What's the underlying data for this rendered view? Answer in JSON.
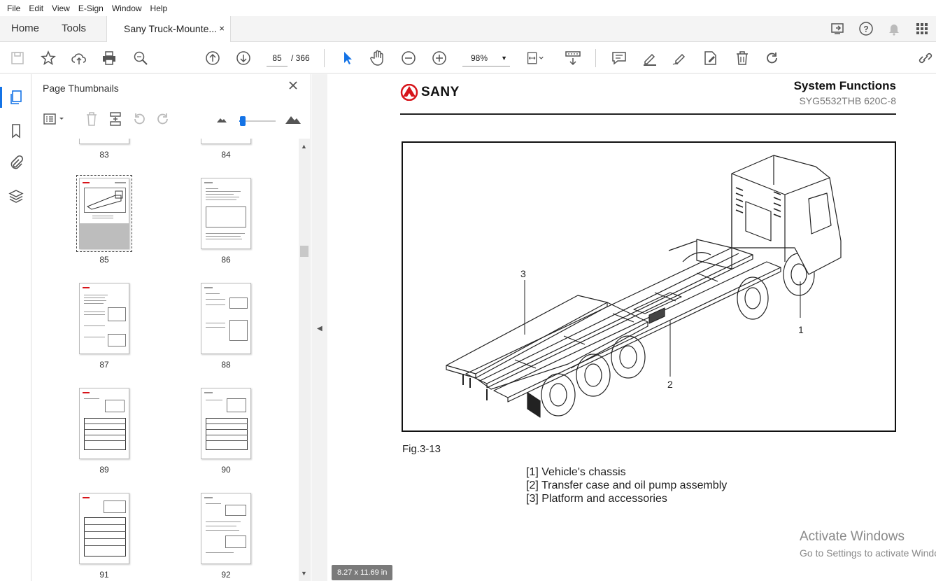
{
  "menu": [
    "File",
    "Edit",
    "View",
    "E-Sign",
    "Window",
    "Help"
  ],
  "tabs": {
    "home": "Home",
    "tools": "Tools",
    "document": "Sany Truck-Mounte...",
    "close": "×"
  },
  "toolbar": {
    "page_current": "85",
    "page_total": "/  366",
    "zoom": "98%"
  },
  "panel": {
    "title": "Page Thumbnails"
  },
  "thumbnails": [
    {
      "label": "83"
    },
    {
      "label": "84"
    },
    {
      "label": "85"
    },
    {
      "label": "86"
    },
    {
      "label": "87"
    },
    {
      "label": "88"
    },
    {
      "label": "89"
    },
    {
      "label": "90"
    },
    {
      "label": "91"
    },
    {
      "label": "92"
    }
  ],
  "document": {
    "brand": "SANY",
    "title": "System Functions",
    "model": "SYG5532THB 620C-8",
    "callouts": [
      "3",
      "1",
      "2"
    ],
    "caption": "Fig.3-13",
    "legend": [
      "[1] Vehicle's chassis",
      "[2] Transfer case and oil pump assembly",
      "[3] Platform and accessories"
    ],
    "page_size": "8.27 x 11.69 in"
  },
  "watermark": {
    "line1": "Activate Windows",
    "line2": "Go to Settings to activate Windows."
  },
  "colors": {
    "accent": "#1473e6",
    "brand_red": "#d7141a"
  }
}
